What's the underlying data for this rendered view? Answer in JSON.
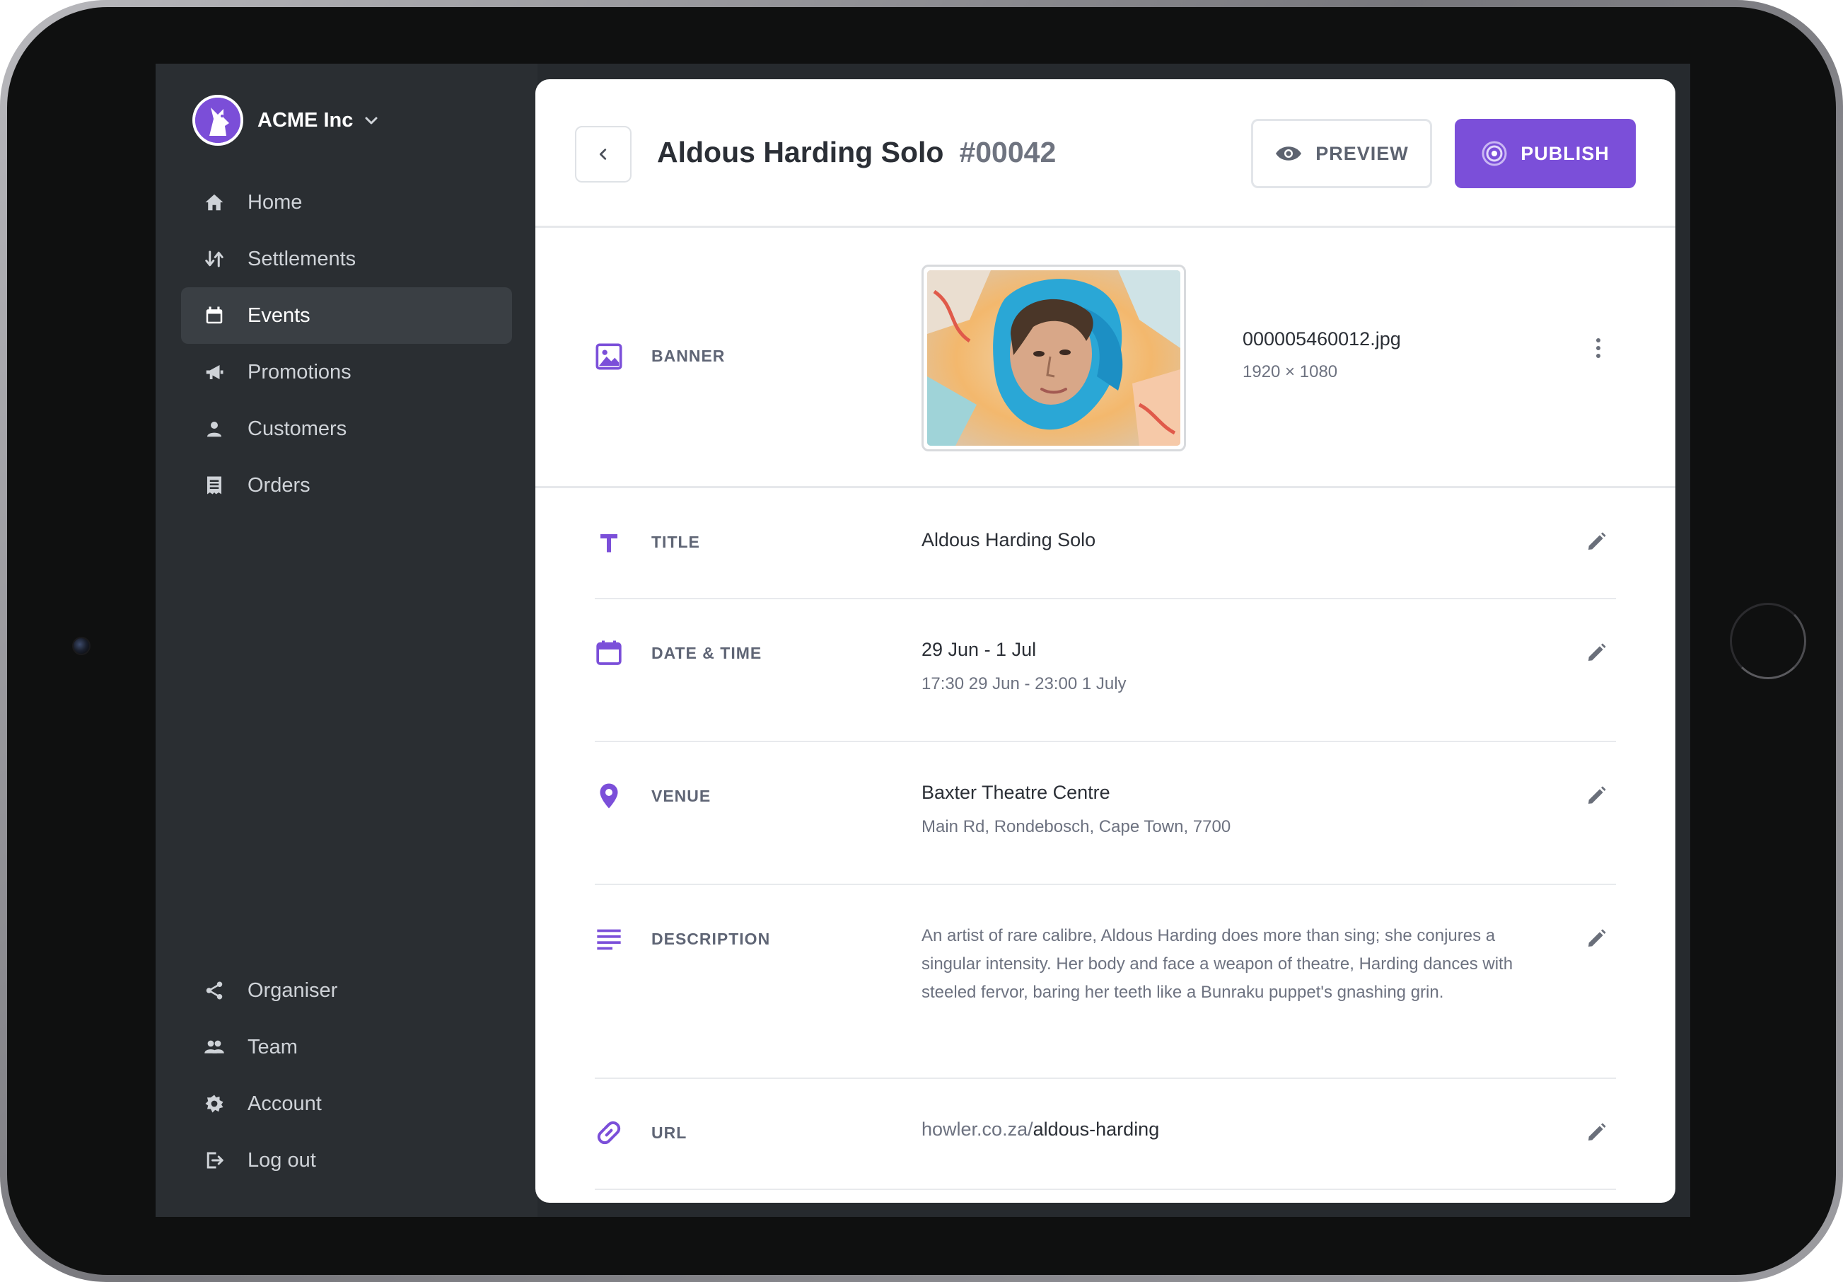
{
  "org": {
    "name": "ACME Inc"
  },
  "nav_top": [
    {
      "label": "Home",
      "icon": "home-icon"
    },
    {
      "label": "Settlements",
      "icon": "swap-vertical-icon"
    },
    {
      "label": "Events",
      "icon": "calendar-icon",
      "active": true
    },
    {
      "label": "Promotions",
      "icon": "megaphone-icon"
    },
    {
      "label": "Customers",
      "icon": "person-icon"
    },
    {
      "label": "Orders",
      "icon": "receipt-icon"
    }
  ],
  "nav_bottom": [
    {
      "label": "Organiser",
      "icon": "share-icon"
    },
    {
      "label": "Team",
      "icon": "people-icon"
    },
    {
      "label": "Account",
      "icon": "gear-icon"
    },
    {
      "label": "Log out",
      "icon": "logout-icon"
    }
  ],
  "header": {
    "title": "Aldous Harding Solo",
    "number": "#00042",
    "preview_label": "PREVIEW",
    "publish_label": "PUBLISH"
  },
  "banner": {
    "label": "BANNER",
    "file_name": "000005460012.jpg",
    "dimensions": "1920 × 1080"
  },
  "fields": {
    "title": {
      "label": "TITLE",
      "value": "Aldous Harding Solo"
    },
    "datetime": {
      "label": "DATE & TIME",
      "value": "29 Jun - 1 Jul",
      "sub": "17:30 29 Jun - 23:00 1 July"
    },
    "venue": {
      "label": "VENUE",
      "value": "Baxter Theatre Centre",
      "sub": "Main Rd, Rondebosch, Cape Town, 7700"
    },
    "description": {
      "label": "DESCRIPTION",
      "value": "An artist of rare calibre, Aldous Harding does more than sing; she conjures a singular intensity.  Her body and face a weapon of theatre, Harding dances with steeled fervor, baring her teeth like a Bunraku puppet's gnashing grin."
    },
    "url": {
      "label": "URL",
      "base": "howler.co.za/",
      "slug": "aldous-harding"
    }
  },
  "colors": {
    "accent": "#7b4fd9",
    "sidebar": "#2a2e32",
    "active_item": "#3a3f44"
  }
}
